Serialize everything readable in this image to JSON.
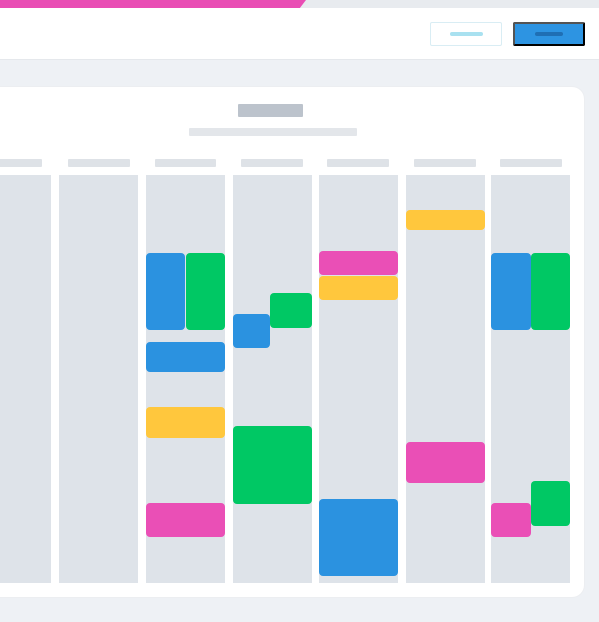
{
  "theme": {
    "page_background": "#EEF1F5",
    "topbar_background": "#FFFFFF",
    "accent_pink": "#E94DB4",
    "primary_blue": "#2D94E2",
    "event_colors": {
      "blue": "#2B92E0",
      "green": "#00C864",
      "pink": "#EA4FB6",
      "yellow": "#FFC73D"
    }
  },
  "toolbar": {
    "secondary_button_label": "",
    "primary_button_label": ""
  },
  "calendar": {
    "title": "",
    "subtitle": "",
    "columns": [
      {
        "label": "",
        "events": []
      },
      {
        "label": "",
        "events": []
      },
      {
        "label": "",
        "events": [
          {
            "color": "blue",
            "label": ""
          },
          {
            "color": "green",
            "label": ""
          },
          {
            "color": "blue",
            "label": ""
          },
          {
            "color": "yellow",
            "label": ""
          },
          {
            "color": "pink",
            "label": ""
          }
        ]
      },
      {
        "label": "",
        "events": [
          {
            "color": "blue",
            "label": ""
          },
          {
            "color": "green",
            "label": ""
          },
          {
            "color": "green",
            "label": ""
          }
        ]
      },
      {
        "label": "",
        "events": [
          {
            "color": "pink",
            "label": ""
          },
          {
            "color": "yellow",
            "label": ""
          },
          {
            "color": "blue",
            "label": ""
          }
        ]
      },
      {
        "label": "",
        "events": [
          {
            "color": "yellow",
            "label": ""
          },
          {
            "color": "pink",
            "label": ""
          }
        ]
      },
      {
        "label": "",
        "events": [
          {
            "color": "blue",
            "label": ""
          },
          {
            "color": "green",
            "label": ""
          },
          {
            "color": "pink",
            "label": ""
          },
          {
            "color": "green",
            "label": ""
          }
        ]
      }
    ]
  }
}
